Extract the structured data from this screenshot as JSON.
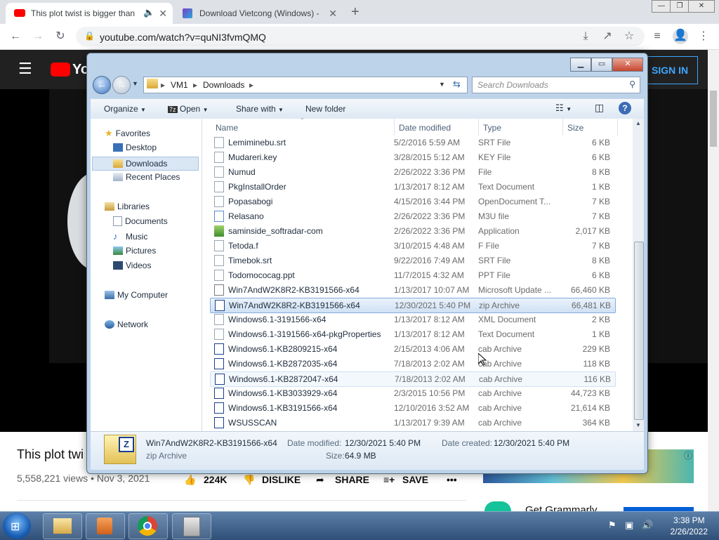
{
  "browser": {
    "tabs": [
      {
        "label": "This plot twist is bigger than"
      },
      {
        "label": "Download Vietcong (Windows) -"
      }
    ],
    "new_tab": "+",
    "url": "youtube.com/watch?v=quNI3fvmQMQ",
    "window_controls": [
      "—",
      "❐",
      "✕"
    ]
  },
  "youtube": {
    "logo": "Yo",
    "sign_in": "SIGN IN",
    "video_title": "This plot twi",
    "views": "5,558,221 views • Nov 3, 2021",
    "likes": "224K",
    "dislike": "DISLIKE",
    "share": "SHARE",
    "save": "SAVE",
    "more": "•••",
    "ad_text": "Get Grammarly"
  },
  "explorer": {
    "breadcrumb": [
      "VM1",
      "Downloads"
    ],
    "search_placeholder": "Search Downloads",
    "commands": {
      "organize": "Organize",
      "open": "Open",
      "share": "Share with",
      "new_folder": "New folder"
    },
    "nav": {
      "favorites": "Favorites",
      "fav_items": [
        "Desktop",
        "Downloads",
        "Recent Places"
      ],
      "libraries": "Libraries",
      "lib_items": [
        "Documents",
        "Music",
        "Pictures",
        "Videos"
      ],
      "computer": "My Computer",
      "network": "Network"
    },
    "columns": {
      "name": "Name",
      "date": "Date modified",
      "type": "Type",
      "size": "Size"
    },
    "files": [
      {
        "name": "Lemiminebu.srt",
        "date": "5/2/2016 5:59 AM",
        "type": "SRT File",
        "size": "6 KB"
      },
      {
        "name": "Mudareri.key",
        "date": "3/28/2015 5:12 AM",
        "type": "KEY File",
        "size": "6 KB"
      },
      {
        "name": "Numud",
        "date": "2/26/2022 3:36 PM",
        "type": "File",
        "size": "8 KB"
      },
      {
        "name": "PkgInstallOrder",
        "date": "1/13/2017 8:12 AM",
        "type": "Text Document",
        "size": "1 KB"
      },
      {
        "name": "Popasabogi",
        "date": "4/15/2016 3:44 PM",
        "type": "OpenDocument T...",
        "size": "7 KB"
      },
      {
        "name": "Relasano",
        "date": "2/26/2022 3:36 PM",
        "type": "M3U file",
        "size": "7 KB"
      },
      {
        "name": "saminside_softradar-com",
        "date": "2/26/2022 3:36 PM",
        "type": "Application",
        "size": "2,017 KB"
      },
      {
        "name": "Tetoda.f",
        "date": "3/10/2015 4:48 AM",
        "type": "F File",
        "size": "7 KB"
      },
      {
        "name": "Timebok.srt",
        "date": "9/22/2016 7:49 AM",
        "type": "SRT File",
        "size": "8 KB"
      },
      {
        "name": "Todomococag.ppt",
        "date": "11/7/2015 4:32 AM",
        "type": "PPT File",
        "size": "6 KB"
      },
      {
        "name": "Win7AndW2K8R2-KB3191566-x64",
        "date": "1/13/2017 10:07 AM",
        "type": "Microsoft Update ...",
        "size": "66,460 KB"
      },
      {
        "name": "Win7AndW2K8R2-KB3191566-x64",
        "date": "12/30/2021 5:40 PM",
        "type": "zip Archive",
        "size": "66,481 KB"
      },
      {
        "name": "Windows6.1-3191566-x64",
        "date": "1/13/2017 8:12 AM",
        "type": "XML Document",
        "size": "2 KB"
      },
      {
        "name": "Windows6.1-3191566-x64-pkgProperties",
        "date": "1/13/2017 8:12 AM",
        "type": "Text Document",
        "size": "1 KB"
      },
      {
        "name": "Windows6.1-KB2809215-x64",
        "date": "2/15/2013 4:06 AM",
        "type": "cab Archive",
        "size": "229 KB"
      },
      {
        "name": "Windows6.1-KB2872035-x64",
        "date": "7/18/2013 2:02 AM",
        "type": "cab Archive",
        "size": "118 KB"
      },
      {
        "name": "Windows6.1-KB2872047-x64",
        "date": "7/18/2013 2:02 AM",
        "type": "cab Archive",
        "size": "116 KB"
      },
      {
        "name": "Windows6.1-KB3033929-x64",
        "date": "2/3/2015 10:56 PM",
        "type": "cab Archive",
        "size": "44,723 KB"
      },
      {
        "name": "Windows6.1-KB3191566-x64",
        "date": "12/10/2016 3:52 AM",
        "type": "cab Archive",
        "size": "21,614 KB"
      },
      {
        "name": "WSUSSCAN",
        "date": "1/13/2017 9:39 AM",
        "type": "cab Archive",
        "size": "364 KB"
      }
    ],
    "details": {
      "name": "Win7AndW2K8R2-KB3191566-x64",
      "type": "zip Archive",
      "modified_label": "Date modified:",
      "modified": "12/30/2021 5:40 PM",
      "created_label": "Date created:",
      "created": "12/30/2021 5:40 PM",
      "size_label": "Size:",
      "size": "64.9 MB"
    }
  },
  "taskbar": {
    "time": "3:38 PM",
    "date": "2/26/2022"
  }
}
